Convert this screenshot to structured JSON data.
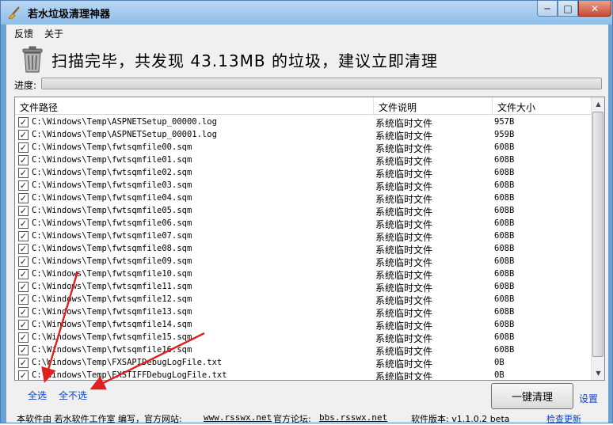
{
  "window": {
    "title": "若水垃圾清理神器",
    "min_glyph": "─",
    "max_glyph": "□",
    "close_glyph": "✕"
  },
  "menu": [
    "反馈",
    "关于"
  ],
  "headline": "扫描完毕，共发现 43.13MB 的垃圾，建议立即清理",
  "progress": {
    "label": "进度:",
    "value_percent": 100
  },
  "list": {
    "columns": [
      "文件路径",
      "文件说明",
      "文件大小"
    ],
    "rows": [
      {
        "path": "C:\\Windows\\Temp\\ASPNETSetup_00000.log",
        "desc": "系统临时文件",
        "size": "957B"
      },
      {
        "path": "C:\\Windows\\Temp\\ASPNETSetup_00001.log",
        "desc": "系统临时文件",
        "size": "959B"
      },
      {
        "path": "C:\\Windows\\Temp\\fwtsqmfile00.sqm",
        "desc": "系统临时文件",
        "size": "608B"
      },
      {
        "path": "C:\\Windows\\Temp\\fwtsqmfile01.sqm",
        "desc": "系统临时文件",
        "size": "608B"
      },
      {
        "path": "C:\\Windows\\Temp\\fwtsqmfile02.sqm",
        "desc": "系统临时文件",
        "size": "608B"
      },
      {
        "path": "C:\\Windows\\Temp\\fwtsqmfile03.sqm",
        "desc": "系统临时文件",
        "size": "608B"
      },
      {
        "path": "C:\\Windows\\Temp\\fwtsqmfile04.sqm",
        "desc": "系统临时文件",
        "size": "608B"
      },
      {
        "path": "C:\\Windows\\Temp\\fwtsqmfile05.sqm",
        "desc": "系统临时文件",
        "size": "608B"
      },
      {
        "path": "C:\\Windows\\Temp\\fwtsqmfile06.sqm",
        "desc": "系统临时文件",
        "size": "608B"
      },
      {
        "path": "C:\\Windows\\Temp\\fwtsqmfile07.sqm",
        "desc": "系统临时文件",
        "size": "608B"
      },
      {
        "path": "C:\\Windows\\Temp\\fwtsqmfile08.sqm",
        "desc": "系统临时文件",
        "size": "608B"
      },
      {
        "path": "C:\\Windows\\Temp\\fwtsqmfile09.sqm",
        "desc": "系统临时文件",
        "size": "608B"
      },
      {
        "path": "C:\\Windows\\Temp\\fwtsqmfile10.sqm",
        "desc": "系统临时文件",
        "size": "608B"
      },
      {
        "path": "C:\\Windows\\Temp\\fwtsqmfile11.sqm",
        "desc": "系统临时文件",
        "size": "608B"
      },
      {
        "path": "C:\\Windows\\Temp\\fwtsqmfile12.sqm",
        "desc": "系统临时文件",
        "size": "608B"
      },
      {
        "path": "C:\\Windows\\Temp\\fwtsqmfile13.sqm",
        "desc": "系统临时文件",
        "size": "608B"
      },
      {
        "path": "C:\\Windows\\Temp\\fwtsqmfile14.sqm",
        "desc": "系统临时文件",
        "size": "608B"
      },
      {
        "path": "C:\\Windows\\Temp\\fwtsqmfile15.sqm",
        "desc": "系统临时文件",
        "size": "608B"
      },
      {
        "path": "C:\\Windows\\Temp\\fwtsqmfile16.sqm",
        "desc": "系统临时文件",
        "size": "608B"
      },
      {
        "path": "C:\\Windows\\Temp\\FXSAPIDebugLogFile.txt",
        "desc": "系统临时文件",
        "size": "0B"
      },
      {
        "path": "C:\\Windows\\Temp\\FXSTIFFDebugLogFile.txt",
        "desc": "系统临时文件",
        "size": "0B"
      }
    ],
    "check_glyph": "✓"
  },
  "actions": {
    "select_all": "全选",
    "select_none": "全不选",
    "clean_button": "一键清理",
    "settings": "设置"
  },
  "status": {
    "prefix": "本软件由 若水软件工作室 编写，官方网站:",
    "site": "www.rsswx.net",
    "forum_label": "官方论坛:",
    "forum": "bbs.rsswx.net",
    "version": "软件版本: v1.1.0.2 beta",
    "update": "检查更新"
  },
  "colors": {
    "title_gradient_top": "#b9d7f3",
    "link": "#0b46c8",
    "annotation_arrow": "#e02020"
  },
  "icons": [
    "broom-icon",
    "trash-can-icon",
    "checkbox-icon",
    "annotation-arrow-icon"
  ]
}
